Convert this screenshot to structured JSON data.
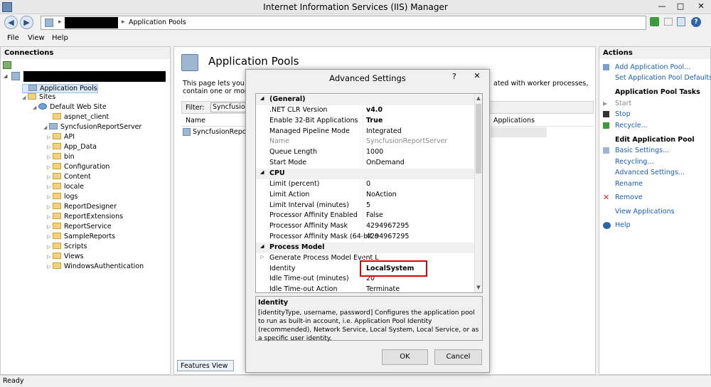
{
  "window": {
    "title": "Internet Information Services (IIS) Manager"
  },
  "address": {
    "path_item": "Application Pools"
  },
  "menu": [
    "File",
    "View",
    "Help"
  ],
  "connections": {
    "title": "Connections",
    "tree": [
      {
        "label": "Application Pools",
        "indent": 0
      },
      {
        "label": "Sites",
        "indent": 0
      },
      {
        "label": "Default Web Site",
        "indent": 1
      },
      {
        "label": "aspnet_client",
        "indent": 2
      },
      {
        "label": "SyncfusionReportServer",
        "indent": 2
      },
      {
        "label": "API",
        "indent": 3
      },
      {
        "label": "App_Data",
        "indent": 3
      },
      {
        "label": "bin",
        "indent": 3
      },
      {
        "label": "Configuration",
        "indent": 3
      },
      {
        "label": "Content",
        "indent": 3
      },
      {
        "label": "locale",
        "indent": 3
      },
      {
        "label": "logs",
        "indent": 3
      },
      {
        "label": "ReportDesigner",
        "indent": 3
      },
      {
        "label": "ReportExtensions",
        "indent": 3
      },
      {
        "label": "ReportService",
        "indent": 3
      },
      {
        "label": "SampleReports",
        "indent": 3
      },
      {
        "label": "Scripts",
        "indent": 3
      },
      {
        "label": "Views",
        "indent": 3
      },
      {
        "label": "WindowsAuthentication",
        "indent": 3
      }
    ]
  },
  "main": {
    "title": "Application Pools",
    "desc_line1": "This page lets you vi",
    "desc_line2": "contain one or more",
    "desc_right": "ated with worker processes,",
    "filter_label": "Filter:",
    "filter_value": "SyncfusionRe",
    "col_name": "Name",
    "col_apps": "Applications",
    "row_name": "SyncfusionRepor",
    "features_view": "Features View"
  },
  "actions": {
    "title": "Actions",
    "items": [
      {
        "label": "Add Application Pool...",
        "kind": "link"
      },
      {
        "label": "Set Application Pool Defaults...",
        "kind": "link"
      },
      {
        "label": "Application Pool Tasks",
        "kind": "header"
      },
      {
        "label": "Start",
        "kind": "disabled"
      },
      {
        "label": "Stop",
        "kind": "link"
      },
      {
        "label": "Recycle...",
        "kind": "link"
      },
      {
        "label": "Edit Application Pool",
        "kind": "header"
      },
      {
        "label": "Basic Settings...",
        "kind": "link"
      },
      {
        "label": "Recycling...",
        "kind": "link"
      },
      {
        "label": "Advanced Settings...",
        "kind": "link"
      },
      {
        "label": "Rename",
        "kind": "link"
      },
      {
        "label": "Remove",
        "kind": "link"
      },
      {
        "label": "View Applications",
        "kind": "link"
      },
      {
        "label": "Help",
        "kind": "link"
      }
    ]
  },
  "status": {
    "text": "Ready"
  },
  "dialog": {
    "title": "Advanced Settings",
    "help_glyph": "?",
    "rows": [
      {
        "type": "cat",
        "name": "(General)"
      },
      {
        "name": ".NET CLR Version",
        "value": "v4.0",
        "bold": true
      },
      {
        "name": "Enable 32-Bit Applications",
        "value": "True",
        "bold": true
      },
      {
        "name": "Managed Pipeline Mode",
        "value": "Integrated"
      },
      {
        "name": "Name",
        "value": "SyncfusionReportServer",
        "grey": true
      },
      {
        "name": "Queue Length",
        "value": "1000"
      },
      {
        "name": "Start Mode",
        "value": "OnDemand"
      },
      {
        "type": "cat",
        "name": "CPU"
      },
      {
        "name": "Limit (percent)",
        "value": "0"
      },
      {
        "name": "Limit Action",
        "value": "NoAction"
      },
      {
        "name": "Limit Interval (minutes)",
        "value": "5"
      },
      {
        "name": "Processor Affinity Enabled",
        "value": "False"
      },
      {
        "name": "Processor Affinity Mask",
        "value": "4294967295"
      },
      {
        "name": "Processor Affinity Mask (64-bit o",
        "value": "4294967295"
      },
      {
        "type": "cat",
        "name": "Process Model"
      },
      {
        "name": "Generate Process Model Event L",
        "value": "",
        "expand": true
      },
      {
        "name": "Identity",
        "value": "LocalSystem",
        "bold": true,
        "highlight": true
      },
      {
        "name": "Idle Time-out (minutes)",
        "value": "20"
      },
      {
        "name": "Idle Time-out Action",
        "value": "Terminate"
      }
    ],
    "desc_title": "Identity",
    "desc_text": "[identityType, username, password] Configures the application pool to run as built-in account, i.e. Application Pool Identity (recommended), Network Service, Local System, Local Service, or as a specific user identity.",
    "ok": "OK",
    "cancel": "Cancel"
  },
  "colors": {
    "highlight_box": "#e00000",
    "link": "#1a5fb4"
  }
}
